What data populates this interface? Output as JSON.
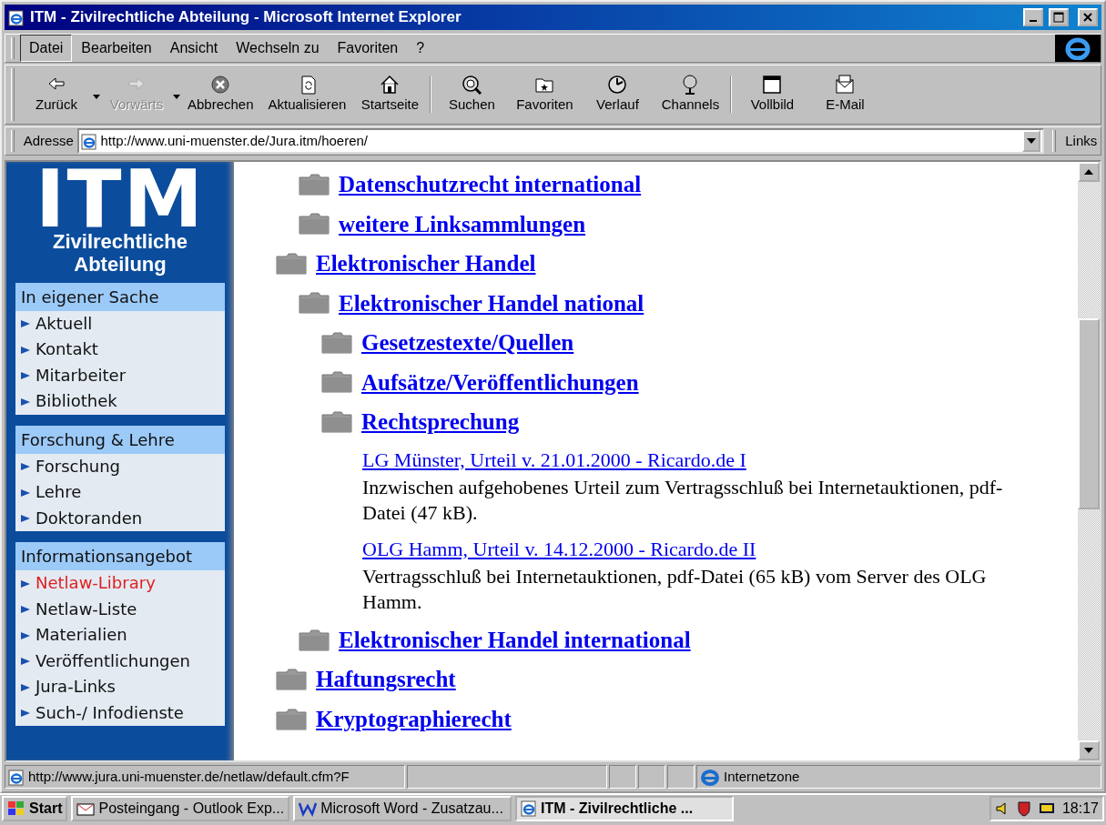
{
  "window": {
    "title": "ITM - Zivilrechtliche Abteilung - Microsoft Internet Explorer"
  },
  "menu": [
    {
      "label": "Datei",
      "selected": true
    },
    {
      "label": "Bearbeiten",
      "selected": false
    },
    {
      "label": "Ansicht",
      "selected": false
    },
    {
      "label": "Wechseln zu",
      "selected": false
    },
    {
      "label": "Favoriten",
      "selected": false
    },
    {
      "label": "?",
      "selected": false
    }
  ],
  "toolbar": [
    [
      {
        "label": "Zurück",
        "kind": "back",
        "disabled": false,
        "dropdown": true
      },
      {
        "label": "Vorwärts",
        "kind": "forward",
        "disabled": true,
        "dropdown": true
      },
      {
        "label": "Abbrechen",
        "kind": "stop",
        "disabled": false,
        "dropdown": false
      },
      {
        "label": "Aktualisieren",
        "kind": "refresh",
        "disabled": false,
        "dropdown": false
      },
      {
        "label": "Startseite",
        "kind": "home",
        "disabled": false,
        "dropdown": false
      }
    ],
    [
      {
        "label": "Suchen",
        "kind": "search",
        "disabled": false,
        "dropdown": false
      },
      {
        "label": "Favoriten",
        "kind": "favorites",
        "disabled": false,
        "dropdown": false
      },
      {
        "label": "Verlauf",
        "kind": "history",
        "disabled": false,
        "dropdown": false
      },
      {
        "label": "Channels",
        "kind": "channels",
        "disabled": false,
        "dropdown": false
      }
    ],
    [
      {
        "label": "Vollbild",
        "kind": "fullscreen",
        "disabled": false,
        "dropdown": false
      },
      {
        "label": "E-Mail",
        "kind": "mail",
        "disabled": false,
        "dropdown": false
      }
    ]
  ],
  "address": {
    "label": "Adresse",
    "value": "http://www.uni-muenster.de/Jura.itm/hoeren/",
    "links": "Links"
  },
  "sidebar": {
    "logo": "ITM",
    "subtitle": "Zivilrechtliche Abteilung",
    "sections": [
      {
        "heading": "In eigener Sache",
        "items": [
          {
            "label": "Aktuell",
            "current": false
          },
          {
            "label": "Kontakt",
            "current": false
          },
          {
            "label": "Mitarbeiter",
            "current": false
          },
          {
            "label": "Bibliothek",
            "current": false
          }
        ]
      },
      {
        "heading": "Forschung & Lehre",
        "items": [
          {
            "label": "Forschung",
            "current": false
          },
          {
            "label": "Lehre",
            "current": false
          },
          {
            "label": "Doktoranden",
            "current": false
          }
        ]
      },
      {
        "heading": "Informationsangebot",
        "items": [
          {
            "label": "Netlaw-Library",
            "current": true
          },
          {
            "label": "Netlaw-Liste",
            "current": false
          },
          {
            "label": "Materialien",
            "current": false
          },
          {
            "label": "Veröffentlichungen",
            "current": false
          },
          {
            "label": "Jura-Links",
            "current": false
          },
          {
            "label": "Such-/ Infodienste",
            "current": false
          }
        ]
      }
    ]
  },
  "continued_items": [
    {
      "label": "Datenschutzrecht international"
    },
    {
      "label": "weitere Linksammlungen"
    }
  ],
  "tree": [
    {
      "label": "Elektronischer Handel",
      "children": [
        {
          "label": "Elektronischer Handel national",
          "children": [
            {
              "label": "Gesetzestexte/Quellen"
            },
            {
              "label": "Aufsätze/Veröffentlichungen"
            },
            {
              "label": "Rechtsprechung",
              "documents": [
                {
                  "title": "LG Münster, Urteil v. 21.01.2000 - Ricardo.de I",
                  "description": "Inzwischen aufgehobenes Urteil zum Vertragsschluß bei Internetauktionen, pdf-Datei (47 kB)."
                },
                {
                  "title": "OLG Hamm, Urteil v. 14.12.2000 - Ricardo.de II",
                  "description": "Vertragsschluß bei Internetauktionen, pdf-Datei (65 kB) vom Server des OLG Hamm."
                }
              ]
            }
          ]
        },
        {
          "label": "Elektronischer Handel international"
        }
      ]
    },
    {
      "label": "Haftungsrecht"
    },
    {
      "label": "Kryptographierecht"
    }
  ],
  "status_bar": {
    "url": "http://www.jura.uni-muenster.de/netlaw/default.cfm?F",
    "zone": "Internetzone"
  },
  "taskbar": {
    "start": "Start",
    "tasks": [
      {
        "label": "Posteingang - Outlook Exp...",
        "kind": "outlook",
        "selected": false
      },
      {
        "label": "Microsoft Word - Zusatzau...",
        "kind": "word",
        "selected": false
      },
      {
        "label": "ITM - Zivilrechtliche ...",
        "kind": "ie",
        "selected": true
      }
    ],
    "clock": "18:17"
  }
}
